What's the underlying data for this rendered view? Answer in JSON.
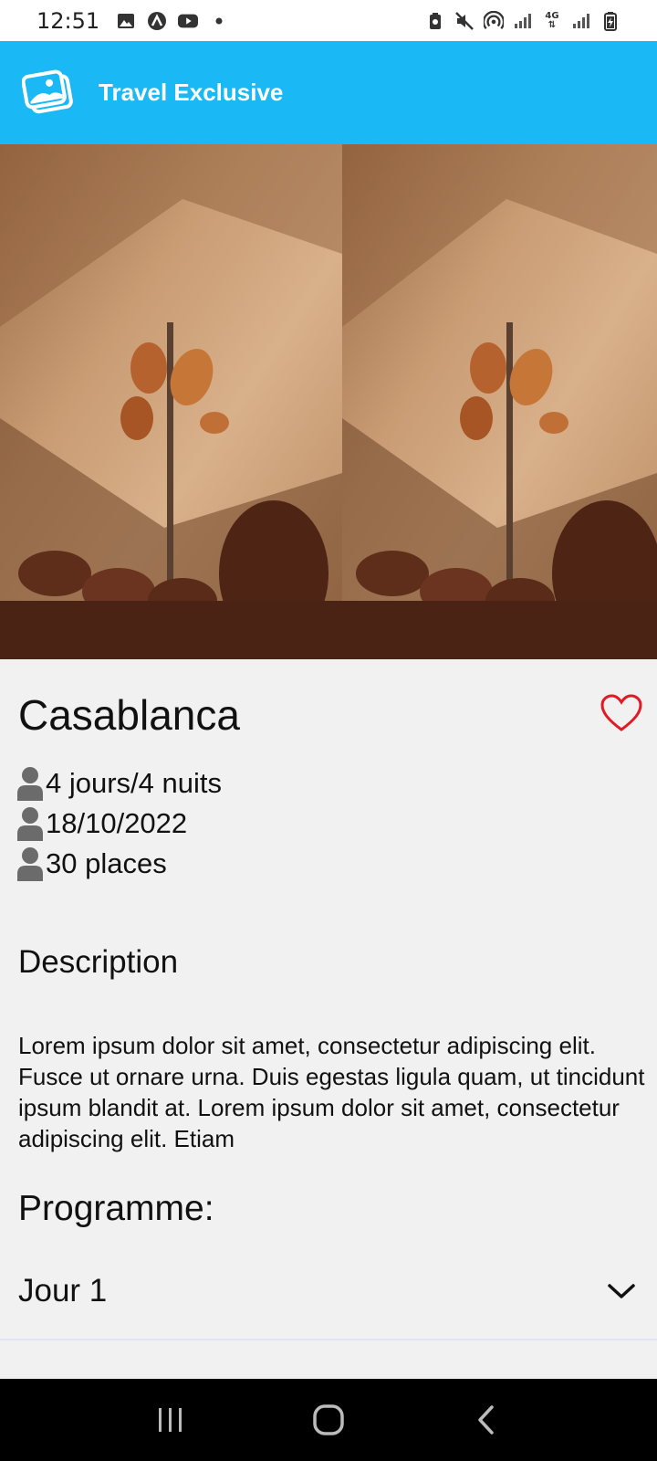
{
  "status_bar": {
    "time": "12:51",
    "left_icons": [
      "gallery-icon",
      "app-a-icon",
      "youtube-icon",
      "dot-icon"
    ],
    "right_icons": [
      "battery-saver-icon",
      "mute-icon",
      "hotspot-icon",
      "signal-icon",
      "4g-icon",
      "signal-icon",
      "battery-charging-icon"
    ],
    "network_label": "4G"
  },
  "app_bar": {
    "title": "Travel Exclusive",
    "background": "#1ab8f5",
    "logo_icon": "image-gallery-icon"
  },
  "hero": {
    "images": [
      "pottery-wall-photo",
      "pottery-wall-photo"
    ]
  },
  "trip": {
    "city": "Casablanca",
    "favorite_icon": "heart-outline-icon",
    "favorite_color": "#e01b24",
    "info": [
      {
        "icon": "person-icon",
        "text": "4 jours/4 nuits"
      },
      {
        "icon": "person-icon",
        "text": "18/10/2022"
      },
      {
        "icon": "person-icon",
        "text": "30 places"
      }
    ],
    "description_heading": "Description",
    "description": "Lorem ipsum dolor sit amet, consectetur adipiscing elit. Fusce ut ornare urna. Duis egestas ligula quam, ut tincidunt ipsum blandit at. Lorem ipsum dolor sit amet, consectetur adipiscing elit. Etiam",
    "program_heading": "Programme:",
    "days": [
      {
        "label": "Jour 1",
        "icon": "chevron-down-icon"
      }
    ]
  },
  "nav_bar": {
    "buttons": [
      "recent-apps-icon",
      "home-icon",
      "back-icon"
    ]
  }
}
